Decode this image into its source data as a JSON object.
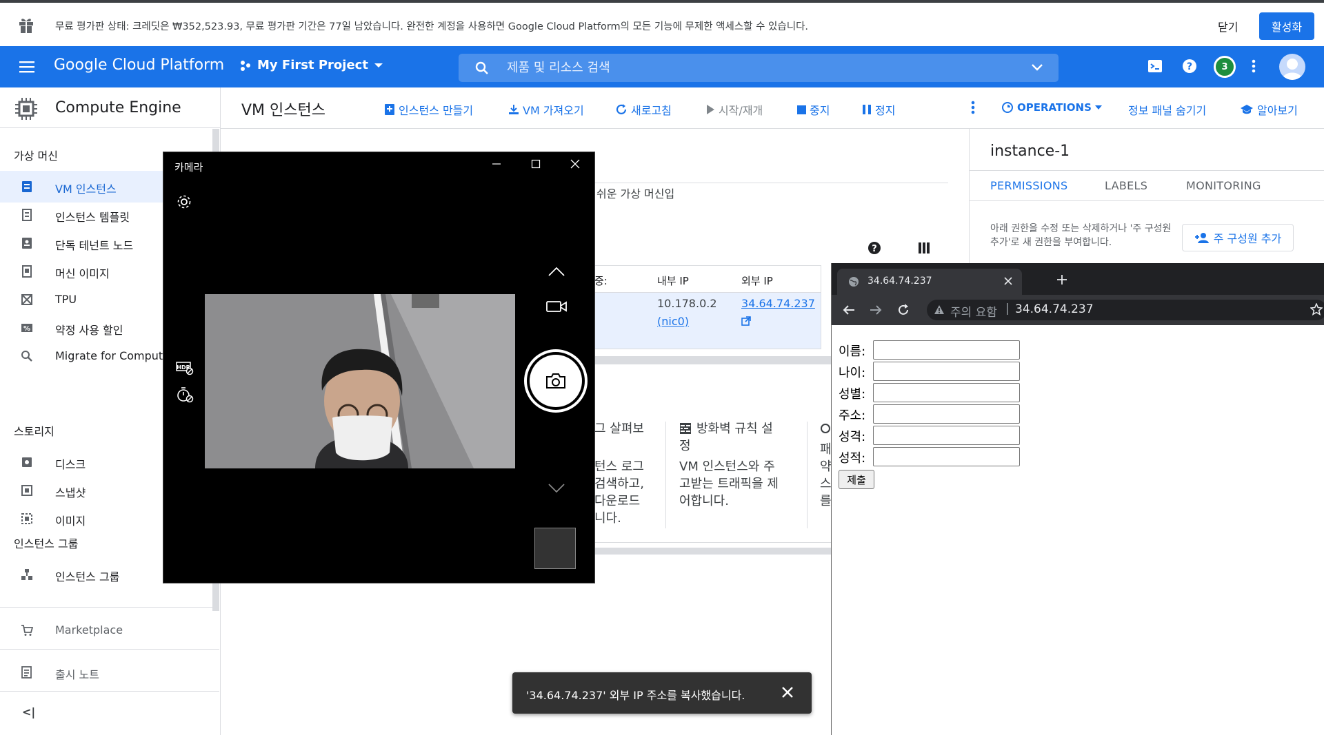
{
  "trial_bar": {
    "message": "무료 평가판 상태: 크레딧은 ₩352,523.93, 무료 평가판 기간은 77일 남았습니다. 완전한 계정을 사용하면 Google Cloud Platform의 모든 기능에 무제한 액세스할 수 있습니다.",
    "close_label": "닫기",
    "activate_label": "활성화"
  },
  "header": {
    "brand": "Google Cloud Platform",
    "project": "My First Project",
    "search_placeholder": "제품 및 리소스 검색",
    "notification_count": "3"
  },
  "sidebar": {
    "product": "Compute Engine",
    "sections": [
      {
        "label": "가상 머신"
      },
      {
        "label": "스토리지"
      },
      {
        "label": "인스턴스 그룹"
      }
    ],
    "items": [
      {
        "label": "VM 인스턴스",
        "icon": "vm-icon"
      },
      {
        "label": "인스턴스 템플릿",
        "icon": "template-icon"
      },
      {
        "label": "단독 테넌트 노드",
        "icon": "node-icon"
      },
      {
        "label": "머신 이미지",
        "icon": "machine-image-icon"
      },
      {
        "label": "TPU",
        "icon": "tpu-icon"
      },
      {
        "label": "약정 사용 할인",
        "icon": "percent-icon"
      },
      {
        "label": "Migrate for Compute E",
        "icon": "search-icon"
      },
      {
        "label": "디스크",
        "icon": "disk-icon"
      },
      {
        "label": "스냅샷",
        "icon": "snapshot-icon"
      },
      {
        "label": "이미지",
        "icon": "image-icon"
      },
      {
        "label": "인스턴스 그룹",
        "icon": "group-icon"
      }
    ],
    "marketplace": "Marketplace",
    "release_notes": "출시 노트",
    "collapse": "<|"
  },
  "action_bar": {
    "title": "VM 인스턴스",
    "create": "인스턴스 만들기",
    "import": "VM 가져오기",
    "refresh": "새로고침",
    "start": "시작/재개",
    "stop": "중지",
    "suspend": "정지",
    "operations": "OPERATIONS",
    "hide_panel": "정보 패널 숨기기",
    "learn": "알아보기"
  },
  "main": {
    "intro_fragment": "쉬운 가상 머신입",
    "table": {
      "headers": [
        "중:",
        "내부 IP",
        "외부 IP"
      ],
      "internal_ip": "10.178.0.2",
      "nic": "(nic0)",
      "external_ip": "34.64.74.237"
    },
    "cards": {
      "logs_title": "그 살펴보",
      "logs_body": [
        "턴스 로그",
        "검색하고,",
        "다운로드",
        "니다."
      ],
      "firewall_title": "방화벽 규칙 설",
      "firewall_title_2": "정",
      "firewall_body": [
        "VM 인스턴스와 주",
        "고받는 트래픽을 제",
        "어합니다."
      ],
      "third": [
        "패",
        "약",
        "스",
        "를"
      ]
    }
  },
  "info_panel": {
    "instance": "instance-1",
    "tabs": [
      "PERMISSIONS",
      "LABELS",
      "MONITORING"
    ],
    "description": "아래 권한을 수정 또는 삭제하거나 '주 구성원 추가'로 새 권한을 부여합니다.",
    "add_member": "주 구성원 추가"
  },
  "camera": {
    "title": "카메라"
  },
  "browser": {
    "tab_title": "34.64.74.237",
    "warning": "주의 요함",
    "url": "34.64.74.237",
    "fields": [
      "이름:",
      "나이:",
      "성별:",
      "주소:",
      "성격:",
      "성적:"
    ],
    "submit": "제출"
  },
  "snackbar": {
    "message": "'34.64.74.237' 외부 IP 주소를 복사했습니다."
  },
  "colors": {
    "brand_blue": "#1a73e8",
    "active_bg": "#e8f0fe",
    "snackbar": "#323232"
  }
}
